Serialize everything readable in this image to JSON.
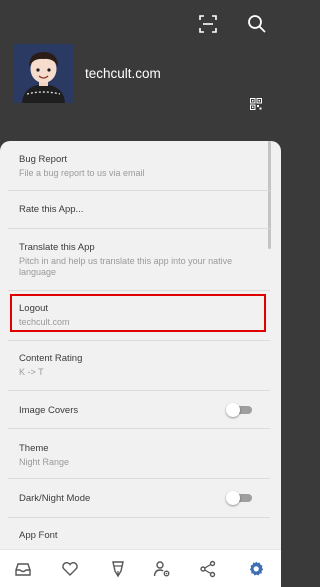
{
  "header": {
    "username": "techcult.com",
    "icons": [
      "scan-icon",
      "search-icon",
      "qr-code-icon"
    ]
  },
  "settings": {
    "bug_report": {
      "title": "Bug Report",
      "subtitle": "File a bug report to us via email"
    },
    "rate_app": {
      "title": "Rate this App..."
    },
    "translate": {
      "title": "Translate this App",
      "subtitle": "Pitch in and help us translate this app into your native language"
    },
    "logout": {
      "title": "Logout",
      "subtitle": "techcult.com"
    },
    "content_rating": {
      "title": "Content Rating",
      "subtitle": "K -> T"
    },
    "image_covers": {
      "title": "Image Covers",
      "enabled": false
    },
    "theme": {
      "title": "Theme",
      "subtitle": "Night Range"
    },
    "dark_mode": {
      "title": "Dark/Night Mode",
      "enabled": false
    },
    "app_font": {
      "title": "App Font"
    }
  },
  "bottom_nav": {
    "items": [
      "library-icon",
      "favorites-icon",
      "write-icon",
      "profile-settings-icon",
      "share-icon",
      "settings-icon"
    ],
    "active": "settings-icon",
    "active_color": "#3f6fb3"
  },
  "colors": {
    "header_bg": "#3a3a3a",
    "panel_bg": "#f1f1f1",
    "highlight": "#e10000"
  }
}
